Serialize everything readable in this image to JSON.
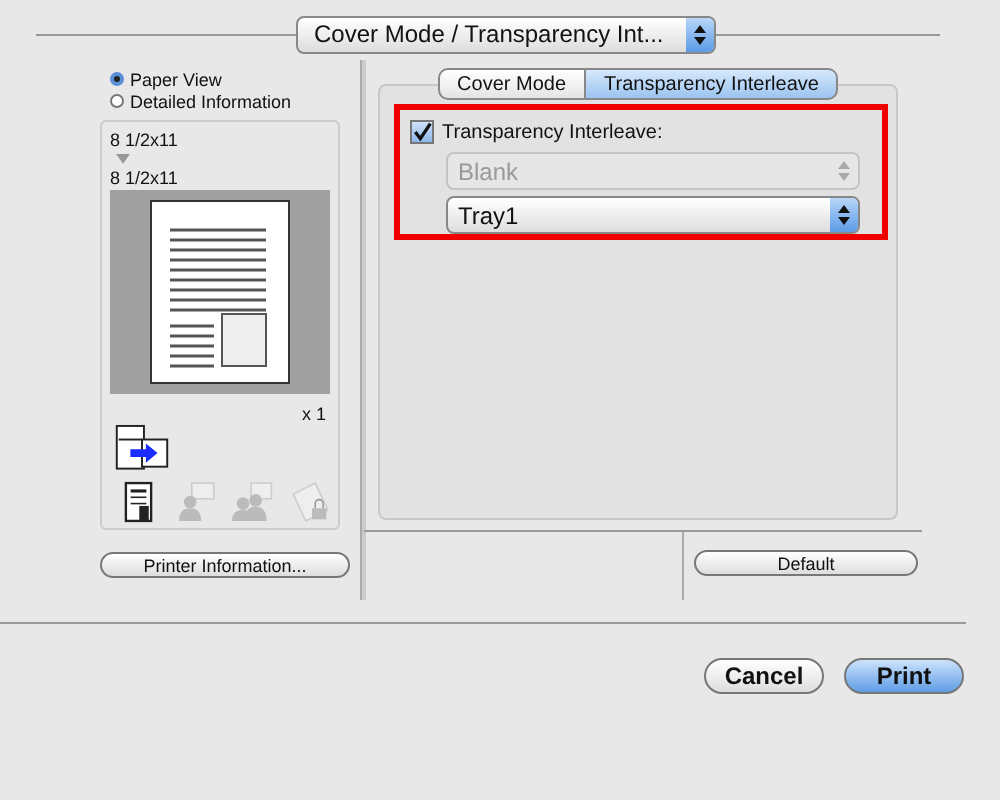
{
  "mode_popup": {
    "value": "Cover Mode / Transparency Int..."
  },
  "view_options": [
    {
      "label": "Paper View",
      "selected": true
    },
    {
      "label": "Detailed Information",
      "selected": false
    }
  ],
  "preview": {
    "original_size": "8 1/2x11",
    "output_size": "8 1/2x11",
    "copies": "x 1"
  },
  "function_icons": [
    {
      "kind": "document",
      "disabled": false
    },
    {
      "kind": "person",
      "disabled": true
    },
    {
      "kind": "people",
      "disabled": true
    },
    {
      "kind": "lock-page",
      "disabled": true
    }
  ],
  "printer_info_button": "Printer Information...",
  "tabs": [
    {
      "label": "Cover Mode",
      "selected": false
    },
    {
      "label": "Transparency Interleave",
      "selected": true
    }
  ],
  "transparency_interleave": {
    "label": "Transparency Interleave:",
    "checked": true,
    "paper": {
      "value": "Blank",
      "disabled": true
    },
    "source": {
      "value": "Tray1",
      "disabled": false
    }
  },
  "default_button": "Default",
  "buttons": [
    {
      "label": "Cancel",
      "kind": "normal"
    },
    {
      "label": "Print",
      "kind": "primary"
    }
  ]
}
